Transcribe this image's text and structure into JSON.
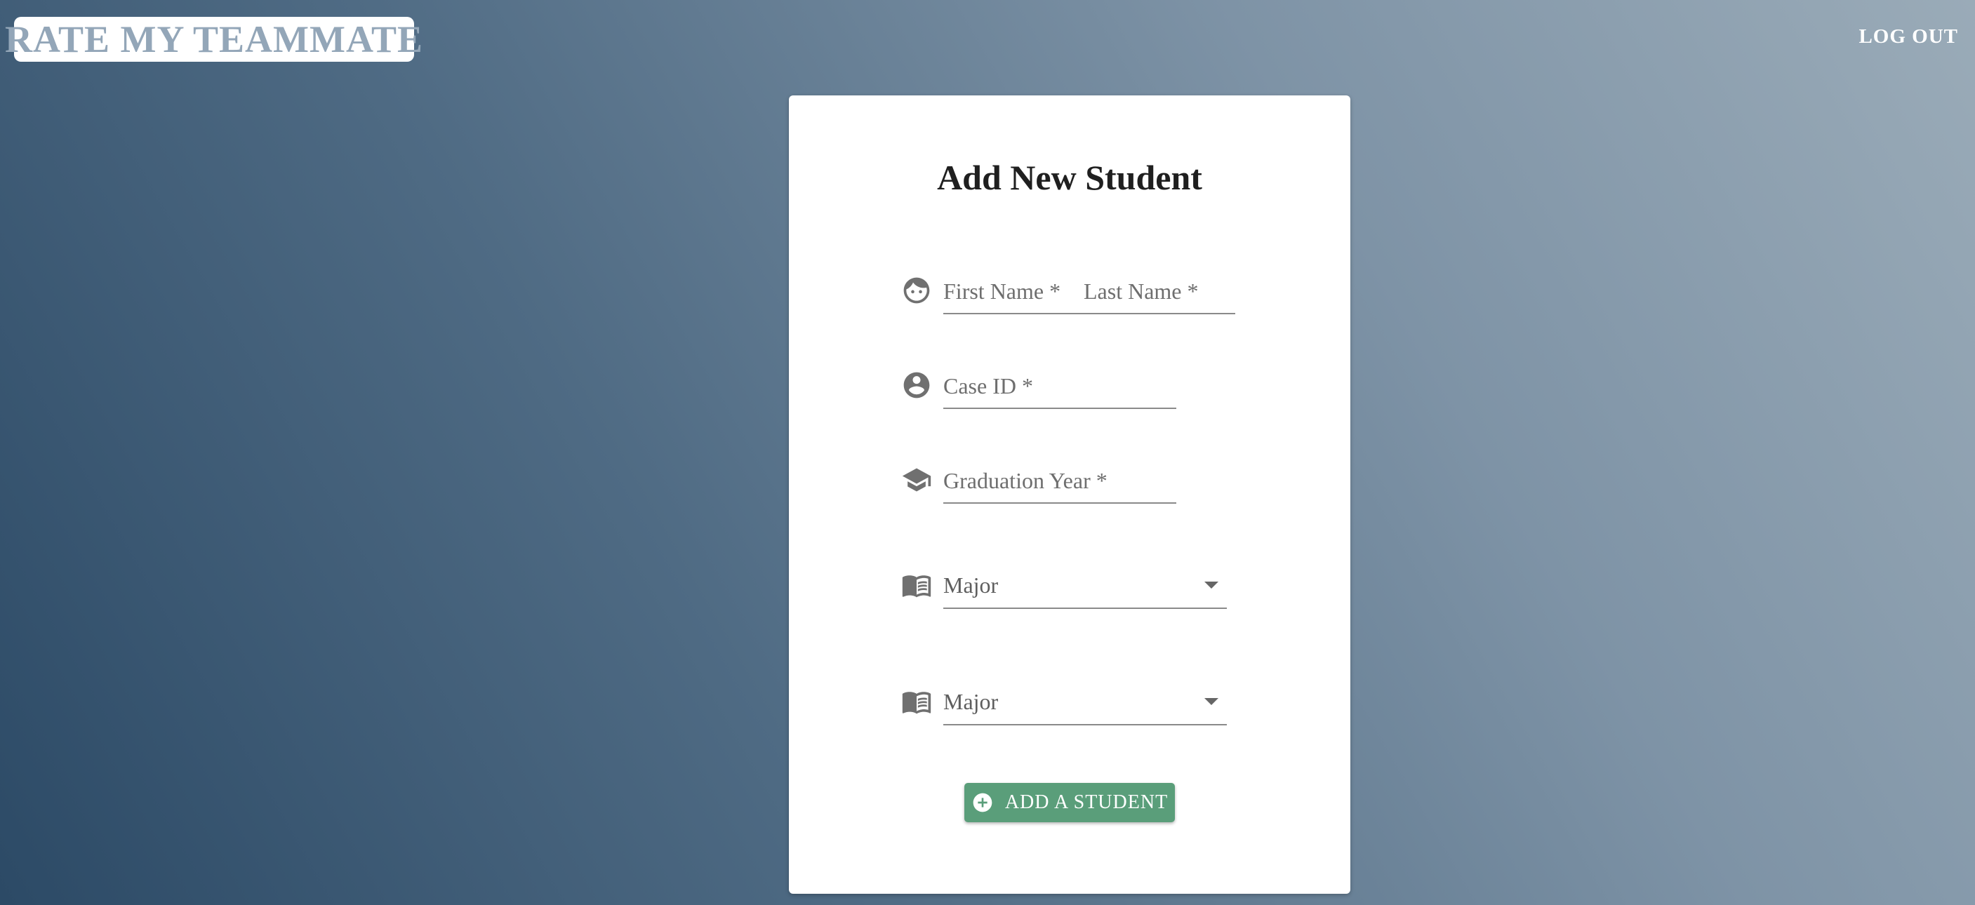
{
  "app": {
    "logo_text": "RATE MY TEAMMATE",
    "logout_label": "LOG OUT"
  },
  "form": {
    "title": "Add New Student",
    "first_name_placeholder": "First Name *",
    "last_name_placeholder": "Last Name *",
    "case_id_placeholder": "Case ID *",
    "graduation_year_placeholder": "Graduation Year *",
    "major_1_value": "Major",
    "major_2_value": "Major",
    "submit_label": "ADD A STUDENT"
  },
  "icons": {
    "name": "face-icon",
    "case_id": "account-circle-icon",
    "graduation": "school-icon",
    "major_1": "book-icon",
    "major_2": "book-icon",
    "submit": "add-circle-icon"
  },
  "colors": {
    "logo_text": "#93a6b8",
    "button": "#5a9e7a",
    "icon": "#707070",
    "bg_dark": "#2c4a66",
    "bg_light": "#9aabb8"
  }
}
